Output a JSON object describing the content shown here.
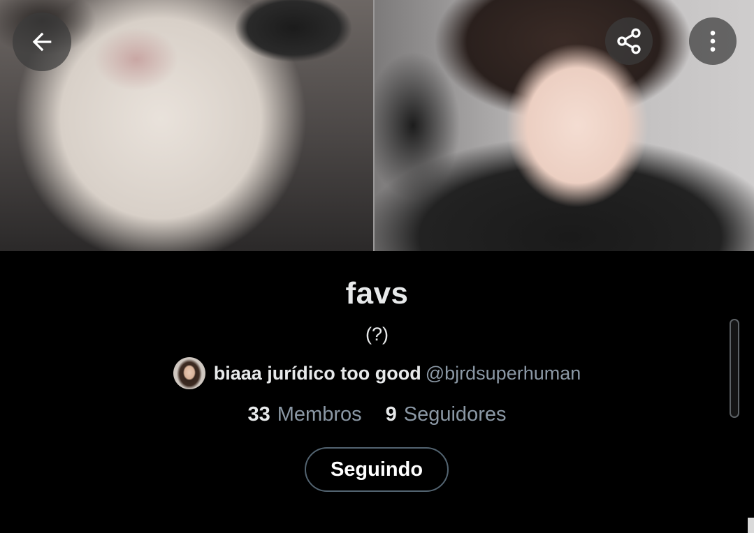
{
  "header": {
    "back_icon": "arrow-left-icon",
    "share_icon": "share-icon",
    "more_icon": "more-vertical-icon"
  },
  "list": {
    "name": "favs",
    "description": "(?)",
    "owner": {
      "display_name": "biaaa jurídico too good",
      "handle": "@bjrdsuperhuman"
    },
    "stats": {
      "members_count": "33",
      "members_label": "Membros",
      "followers_count": "9",
      "followers_label": "Seguidores"
    },
    "follow_button_label": "Seguindo"
  },
  "colors": {
    "background": "#000000",
    "primary_text": "#e7e9ea",
    "secondary_text": "#8b98a5",
    "button_border": "#536471"
  }
}
